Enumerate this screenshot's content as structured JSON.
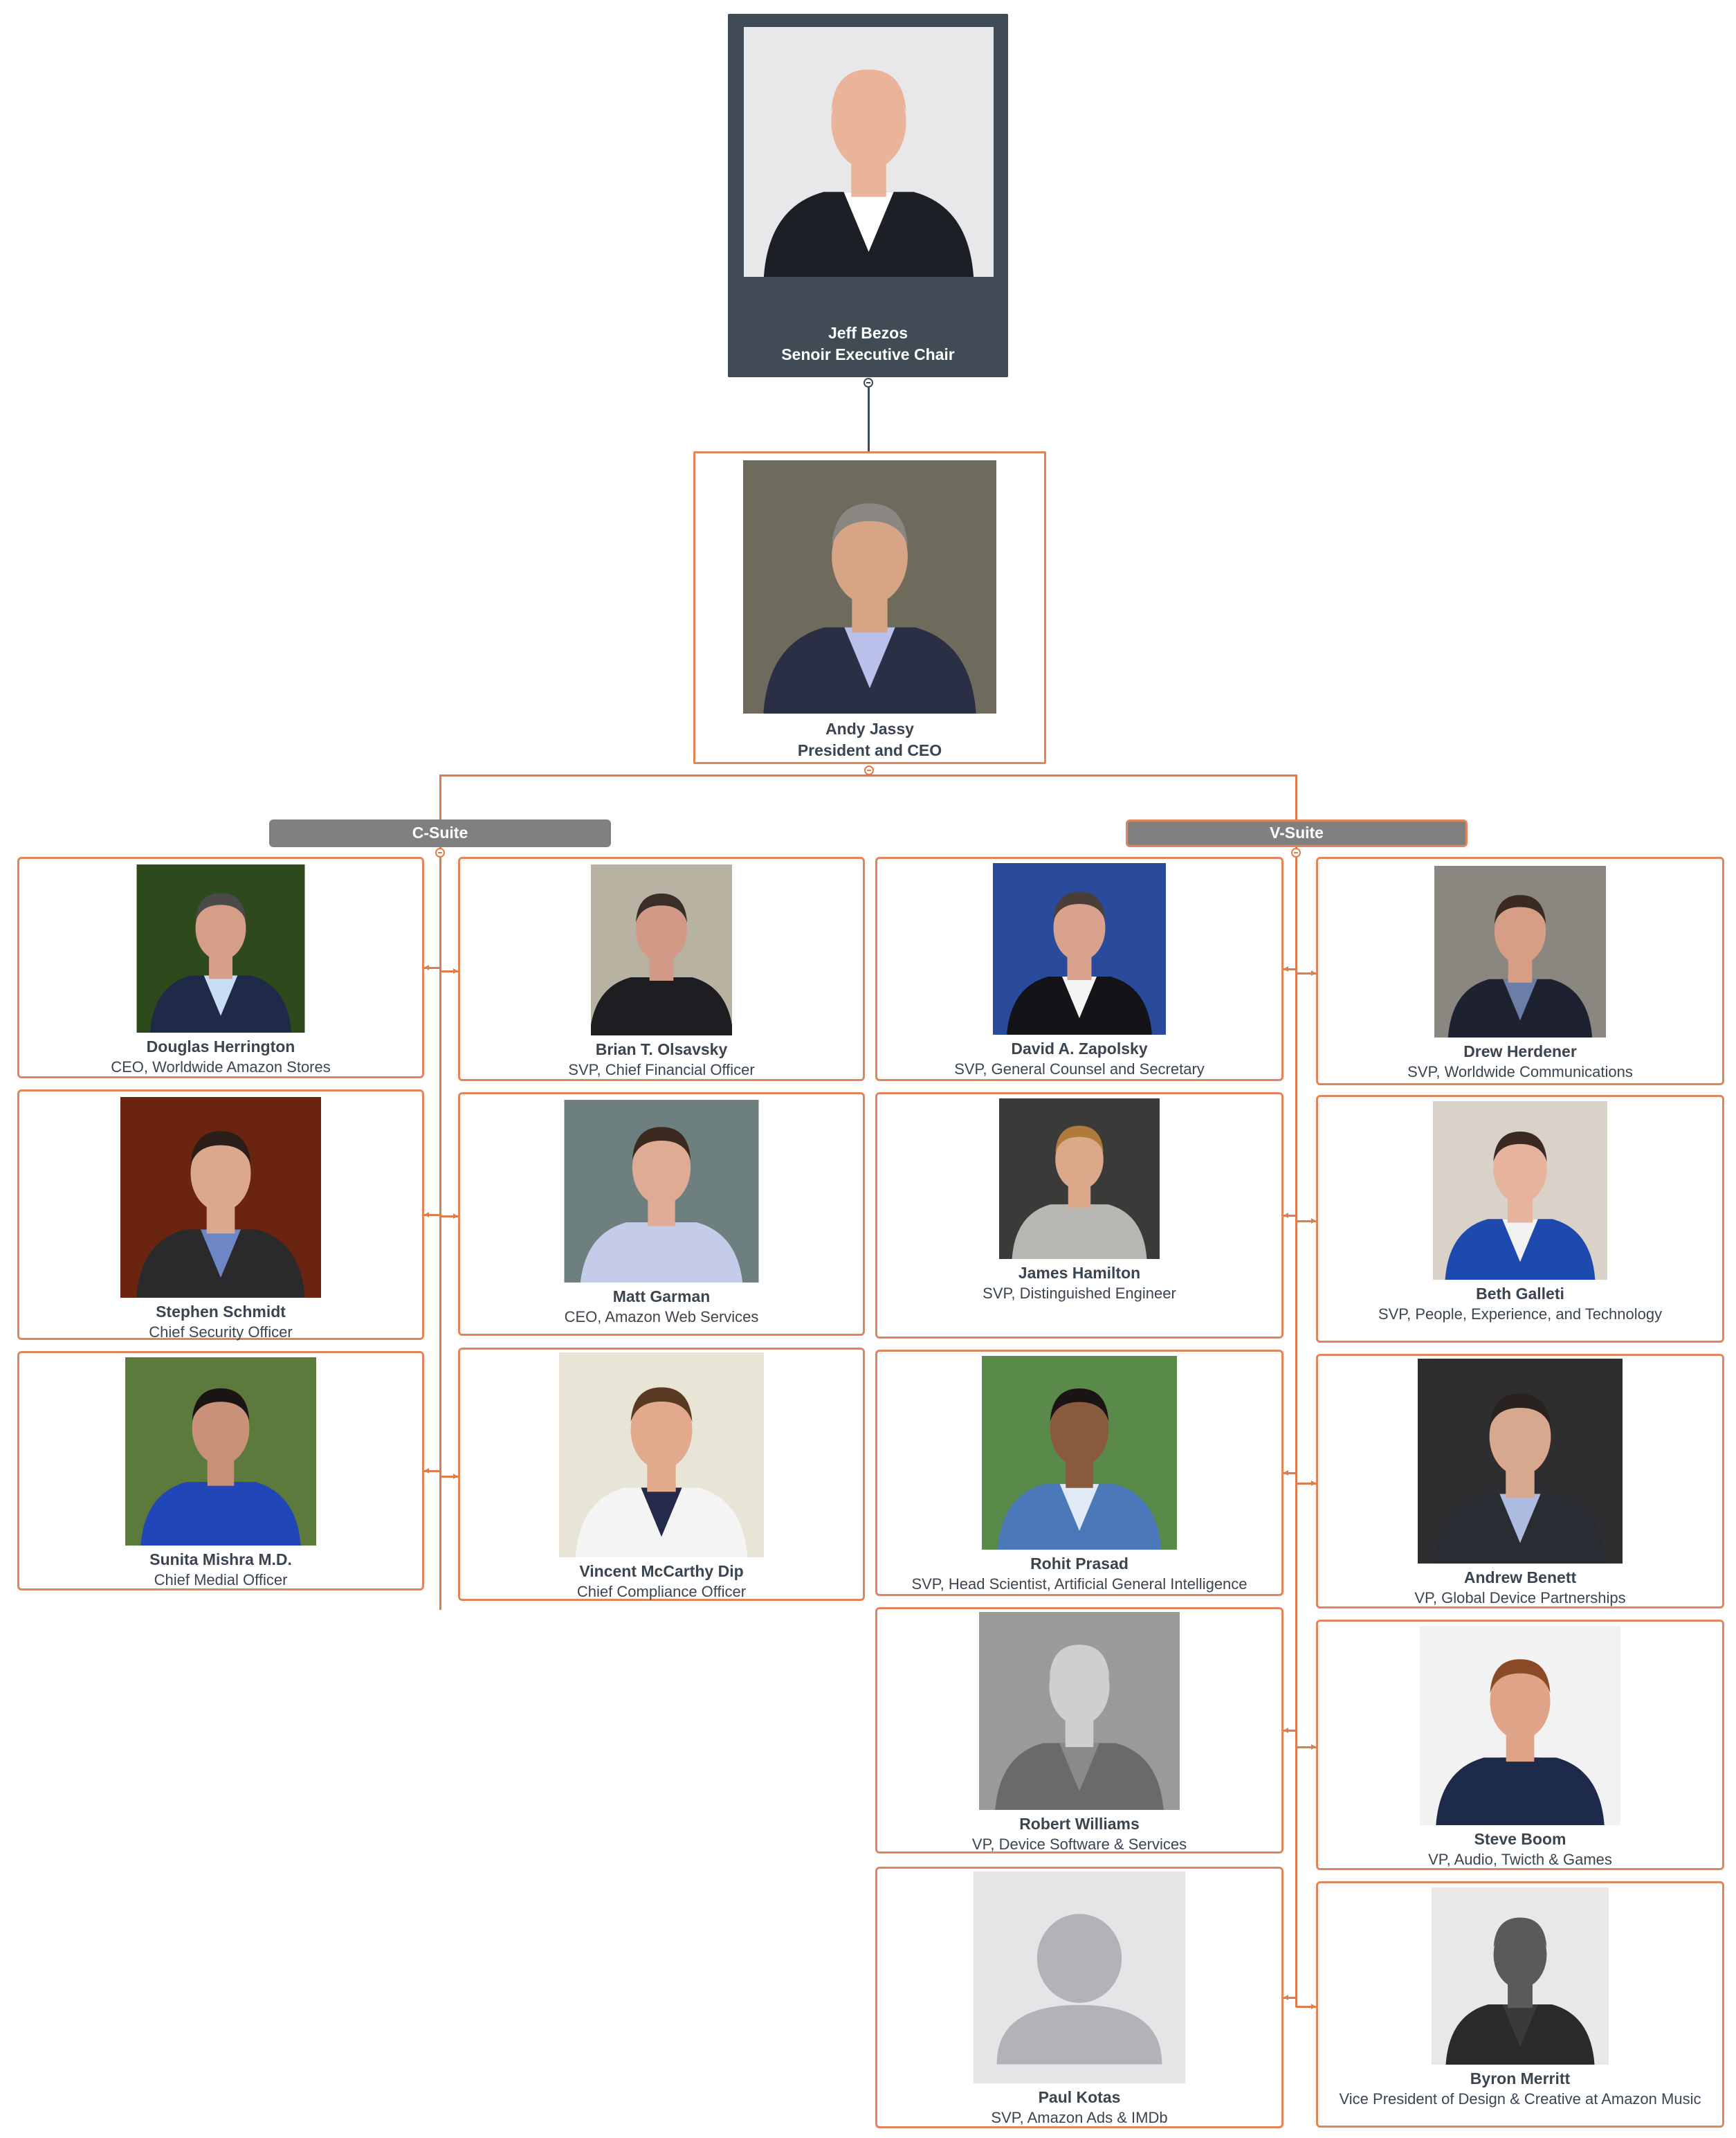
{
  "chart": {
    "root": {
      "name": "Jeff Bezos",
      "role": "Senoir Executive Chair",
      "photo": {
        "bg": "#e8e8ea",
        "skin": "#e9b49a",
        "suit": "#1c1f26",
        "shirt": "#ffffff",
        "hair": "#e9b49a"
      }
    },
    "ceo": {
      "name": "Andy Jassy",
      "role": "President and CEO",
      "photo": {
        "bg": "#6e6a5c",
        "skin": "#d7a585",
        "suit": "#2a2f45",
        "shirt": "#b9c0ea",
        "hair": "#8a8682"
      }
    },
    "groups": [
      {
        "label": "C-Suite",
        "selected": false,
        "members": [
          {
            "name": "Douglas Herrington",
            "role": "CEO, Worldwide Amazon Stores",
            "photo": {
              "bg": "#2e4a1c",
              "skin": "#d69e86",
              "suit": "#1f2a48",
              "shirt": "#c8dcf2",
              "hair": "#4a4a4a"
            }
          },
          {
            "name": "Brian T. Olsavsky",
            "role": "SVP, Chief Financial Officer",
            "photo": {
              "bg": "#b8b2a2",
              "skin": "#d29a86",
              "suit": "#1e1e22",
              "shirt": "#1e1e22",
              "hair": "#3a2e28"
            }
          },
          {
            "name": "Stephen Schmidt",
            "role": "Chief Security Officer",
            "photo": {
              "bg": "#6a2410",
              "skin": "#dba88e",
              "suit": "#2a2a2c",
              "shirt": "#6f86c4",
              "hair": "#2a1e18"
            }
          },
          {
            "name": "Matt Garman",
            "role": "CEO, Amazon Web Services",
            "photo": {
              "bg": "#6e7f80",
              "skin": "#e0ab94",
              "suit": "#c4ccea",
              "shirt": "#c4ccea",
              "hair": "#3a2a20"
            }
          },
          {
            "name": "Sunita Mishra M.D.",
            "role": "Chief Medial Officer",
            "photo": {
              "bg": "#5c7a3c",
              "skin": "#c99278",
              "suit": "#2046b8",
              "shirt": "#2046b8",
              "hair": "#1a1414"
            }
          },
          {
            "name": "Vincent McCarthy Dip",
            "role": "Chief Compliance Officer",
            "photo": {
              "bg": "#e8e4d6",
              "skin": "#e2aa8c",
              "suit": "#f4f4f4",
              "shirt": "#262a4a",
              "hair": "#5a3a22"
            }
          }
        ]
      },
      {
        "label": "V-Suite",
        "selected": true,
        "members": [
          {
            "name": "David A. Zapolsky",
            "role": "SVP, General Counsel and Secretary",
            "photo": {
              "bg": "#2a4a9c",
              "skin": "#d8a28c",
              "suit": "#141418",
              "shirt": "#f4f4f4",
              "hair": "#4a3e36"
            }
          },
          {
            "name": "Drew Herdener",
            "role": "SVP, Worldwide Communications",
            "photo": {
              "bg": "#8a8680",
              "skin": "#d79e86",
              "suit": "#1e2230",
              "shirt": "#6a7ea8",
              "hair": "#3a2a22"
            }
          },
          {
            "name": "James Hamilton",
            "role": "SVP, Distinguished Engineer",
            "photo": {
              "bg": "#3a3a38",
              "skin": "#dca88a",
              "suit": "#b8b6b2",
              "shirt": "#b8b6b2",
              "hair": "#b07a3a"
            }
          },
          {
            "name": "Beth Galleti",
            "role": "SVP, People, Experience, and Technology",
            "photo": {
              "bg": "#d8d2c8",
              "skin": "#e6b49c",
              "suit": "#1e4ab0",
              "shirt": "#f2f2f2",
              "hair": "#3a2a22"
            }
          },
          {
            "name": "Rohit Prasad",
            "role": "SVP, Head Scientist, Artificial General Intelligence",
            "photo": {
              "bg": "#5a8a4a",
              "skin": "#8a5a3e",
              "suit": "#4a78b8",
              "shirt": "#dfeaf4",
              "hair": "#1a1414"
            }
          },
          {
            "name": "Andrew Benett",
            "role": "VP, Global Device Partnerships",
            "photo": {
              "bg": "#2e2e30",
              "skin": "#d8a88e",
              "suit": "#2a2c34",
              "shirt": "#aebbe0",
              "hair": "#2a2220"
            }
          },
          {
            "name": "Robert Williams",
            "role": "VP, Device Software & Services",
            "photo": {
              "bg": "#9a9a9a",
              "skin": "#cfcfcf",
              "suit": "#6a6a6a",
              "shirt": "#8a8a8a",
              "hair": "#cfcfcf"
            }
          },
          {
            "name": "Steve Boom",
            "role": "VP, Audio, Twicth & Games",
            "photo": {
              "bg": "#f2f2f2",
              "skin": "#dfa488",
              "suit": "#1e2a4a",
              "shirt": "#1e2a4a",
              "hair": "#8a4a26"
            }
          },
          {
            "name": "Paul Kotas",
            "role": "SVP, Amazon Ads & IMDb",
            "photo": {
              "placeholder": true,
              "bg": "#e4e5e7",
              "skin": "#b1b3b6",
              "suit": "#b1b3b6",
              "shirt": "#b1b3b6",
              "hair": "#b1b3b6"
            }
          },
          {
            "name": "Byron Merritt",
            "role": "Vice President of Design & Creative at Amazon Music",
            "photo": {
              "bg": "#e8e8e8",
              "skin": "#5a5a5a",
              "suit": "#2a2a2a",
              "shirt": "#3a3a3a",
              "hair": "#5a5a5a"
            }
          }
        ]
      }
    ],
    "colors": {
      "accent": "#e07b4a",
      "root_bg": "#404b56",
      "group_bar": "#808080",
      "text": "#3b4550"
    }
  }
}
